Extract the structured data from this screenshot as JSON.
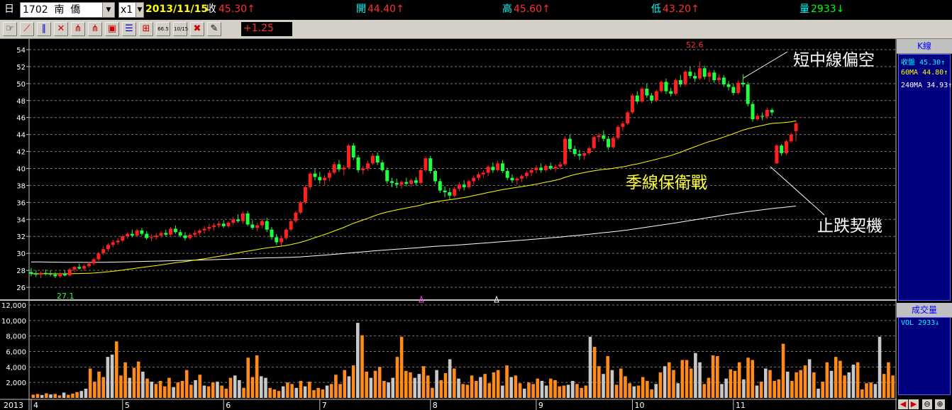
{
  "topbar": {
    "period_label": "日",
    "symbol": "1702  南  僑",
    "multiplier": "x1",
    "date": "2013/11/15",
    "close_label": "收",
    "close_value": "45.30↑",
    "open_label": "開",
    "open_value": "44.40↑",
    "high_label": "高",
    "high_value": "45.60↑",
    "low_label": "低",
    "low_value": "43.20↑",
    "vol_label": "量",
    "vol_value": "2933↓"
  },
  "toolbar": {
    "change_value": "+1.25",
    "icons": [
      "pointer-icon",
      "trendline-icon",
      "parallel-line-icon",
      "cross-line-icon",
      "fan-icon",
      "fibonacci-fan-icon",
      "box-icon",
      "horizontal-lines-icon",
      "gann-icon",
      "ratio-66-5-icon",
      "date-10-15-icon",
      "delete-icon",
      "pen-icon"
    ]
  },
  "side_panel": {
    "price_title": "K線",
    "legend": [
      {
        "label": "收盤 45.30↑",
        "color": "#00ffff"
      },
      {
        "label": "60MA 44.80↑",
        "color": "#ffff00"
      },
      {
        "label": "240MA 34.93↑",
        "color": "#ffffff"
      }
    ],
    "volume_title": "成交量",
    "volume_legend": "VOL 2933↓"
  },
  "chart_data": {
    "type": "candlestick",
    "y_ticks": [
      26,
      28,
      30,
      32,
      34,
      36,
      38,
      40,
      42,
      44,
      46,
      48,
      50,
      52,
      54
    ],
    "ylim": [
      25,
      55
    ],
    "volume_ticks": [
      "12,000",
      "10,000",
      "8,000",
      "6,000",
      "4,000",
      "2,000"
    ],
    "volume_ylim": [
      0,
      12000
    ],
    "x_axis_labels": [
      {
        "label": "2013",
        "day": -2
      },
      {
        "label": "4",
        "day": 0
      },
      {
        "label": "5",
        "day": 19
      },
      {
        "label": "6",
        "day": 40
      },
      {
        "label": "7",
        "day": 60
      },
      {
        "label": "8",
        "day": 83
      },
      {
        "label": "9",
        "day": 105
      },
      {
        "label": "10",
        "day": 125
      },
      {
        "label": "11",
        "day": 146
      }
    ],
    "peak_label": "52.6",
    "trough_label": "27.1",
    "annotations": [
      "短中線偏空",
      "季線保衛戰",
      "止跌契機"
    ],
    "ohlc": [
      [
        27.8,
        28.3,
        27.3,
        27.6
      ],
      [
        27.6,
        28.0,
        27.2,
        27.5
      ],
      [
        27.5,
        27.9,
        27.1,
        27.7
      ],
      [
        27.7,
        28.1,
        27.4,
        27.6
      ],
      [
        27.6,
        28.0,
        27.3,
        27.5
      ],
      [
        27.5,
        27.8,
        27.1,
        27.3
      ],
      [
        27.3,
        27.8,
        27.1,
        27.6
      ],
      [
        27.6,
        28.0,
        27.3,
        27.4
      ],
      [
        27.4,
        28.3,
        27.3,
        28.1
      ],
      [
        28.1,
        28.5,
        27.8,
        28.4
      ],
      [
        28.4,
        28.8,
        28.1,
        28.2
      ],
      [
        28.2,
        28.7,
        28.0,
        28.5
      ],
      [
        28.5,
        29.0,
        28.3,
        28.8
      ],
      [
        28.8,
        29.5,
        28.6,
        29.3
      ],
      [
        29.3,
        30.2,
        29.1,
        30.0
      ],
      [
        30.0,
        30.8,
        29.8,
        30.5
      ],
      [
        30.5,
        31.2,
        30.2,
        31.0
      ],
      [
        31.0,
        31.6,
        30.7,
        31.3
      ],
      [
        31.3,
        31.8,
        31.0,
        31.5
      ],
      [
        31.5,
        32.2,
        31.3,
        32.0
      ],
      [
        32.0,
        32.5,
        31.7,
        32.3
      ],
      [
        32.3,
        32.8,
        31.9,
        32.1
      ],
      [
        32.1,
        32.9,
        32.0,
        32.7
      ],
      [
        32.7,
        33.0,
        32.1,
        32.3
      ],
      [
        32.3,
        32.6,
        31.6,
        31.8
      ],
      [
        31.8,
        32.2,
        31.4,
        31.9
      ],
      [
        31.9,
        32.4,
        31.6,
        32.1
      ],
      [
        32.1,
        32.6,
        31.8,
        32.4
      ],
      [
        32.4,
        32.8,
        32.0,
        32.2
      ],
      [
        32.2,
        33.1,
        32.1,
        32.9
      ],
      [
        32.9,
        33.3,
        32.3,
        32.5
      ],
      [
        32.5,
        32.8,
        31.9,
        32.1
      ],
      [
        32.1,
        32.5,
        31.5,
        31.8
      ],
      [
        31.8,
        32.4,
        31.6,
        32.2
      ],
      [
        32.2,
        32.7,
        31.9,
        32.4
      ],
      [
        32.4,
        32.9,
        32.1,
        32.7
      ],
      [
        32.7,
        33.2,
        32.3,
        32.9
      ],
      [
        32.9,
        33.5,
        32.6,
        33.1
      ],
      [
        33.1,
        33.6,
        32.7,
        33.3
      ],
      [
        33.3,
        33.8,
        33.0,
        33.5
      ],
      [
        33.5,
        33.9,
        33.0,
        33.2
      ],
      [
        33.2,
        33.8,
        33.0,
        33.6
      ],
      [
        33.6,
        34.3,
        33.3,
        34.0
      ],
      [
        34.0,
        34.6,
        33.6,
        33.8
      ],
      [
        33.8,
        34.9,
        33.5,
        34.7
      ],
      [
        34.7,
        35.0,
        33.2,
        33.4
      ],
      [
        33.4,
        33.9,
        32.8,
        33.0
      ],
      [
        33.0,
        33.6,
        32.6,
        33.3
      ],
      [
        33.3,
        34.1,
        33.0,
        33.8
      ],
      [
        33.8,
        34.2,
        32.5,
        32.8
      ],
      [
        32.8,
        33.1,
        31.6,
        31.9
      ],
      [
        31.9,
        32.3,
        31.0,
        31.3
      ],
      [
        31.3,
        32.0,
        30.9,
        31.8
      ],
      [
        31.8,
        33.0,
        31.6,
        32.8
      ],
      [
        32.8,
        34.0,
        32.6,
        33.8
      ],
      [
        33.8,
        35.0,
        33.6,
        34.8
      ],
      [
        34.8,
        36.2,
        34.6,
        36.0
      ],
      [
        36.0,
        38.0,
        35.8,
        37.8
      ],
      [
        37.8,
        39.6,
        37.5,
        39.4
      ],
      [
        39.4,
        40.0,
        38.6,
        39.0
      ],
      [
        39.0,
        39.6,
        38.2,
        38.6
      ],
      [
        38.6,
        39.2,
        38.0,
        38.9
      ],
      [
        38.9,
        39.8,
        38.5,
        39.5
      ],
      [
        39.5,
        40.8,
        39.3,
        40.5
      ],
      [
        40.5,
        41.0,
        39.6,
        39.9
      ],
      [
        39.9,
        40.4,
        39.2,
        40.1
      ],
      [
        40.1,
        42.9,
        39.9,
        42.7
      ],
      [
        42.7,
        43.0,
        41.0,
        41.3
      ],
      [
        41.3,
        41.6,
        39.5,
        39.8
      ],
      [
        39.8,
        40.3,
        39.3,
        40.0
      ],
      [
        40.0,
        40.9,
        39.7,
        40.6
      ],
      [
        40.6,
        41.8,
        40.4,
        41.5
      ],
      [
        41.5,
        41.9,
        40.4,
        40.7
      ],
      [
        40.7,
        41.0,
        39.6,
        39.8
      ],
      [
        39.8,
        40.1,
        38.2,
        38.5
      ],
      [
        38.5,
        38.9,
        37.8,
        38.3
      ],
      [
        38.3,
        38.8,
        37.7,
        38.1
      ],
      [
        38.1,
        38.6,
        37.6,
        38.4
      ],
      [
        38.4,
        38.9,
        37.9,
        38.2
      ],
      [
        38.2,
        38.8,
        37.8,
        38.6
      ],
      [
        38.6,
        39.0,
        38.0,
        38.3
      ],
      [
        38.3,
        40.1,
        38.1,
        39.8
      ],
      [
        39.8,
        41.4,
        39.6,
        41.2
      ],
      [
        41.2,
        41.5,
        39.4,
        39.7
      ],
      [
        39.7,
        39.9,
        38.2,
        38.5
      ],
      [
        38.5,
        38.8,
        37.1,
        37.4
      ],
      [
        37.4,
        37.9,
        36.6,
        37.2
      ],
      [
        37.2,
        37.7,
        36.3,
        36.8
      ],
      [
        36.8,
        37.8,
        36.6,
        37.6
      ],
      [
        37.6,
        38.4,
        37.3,
        38.1
      ],
      [
        38.1,
        38.6,
        37.4,
        37.8
      ],
      [
        37.8,
        38.7,
        37.6,
        38.5
      ],
      [
        38.5,
        39.2,
        38.1,
        38.9
      ],
      [
        38.9,
        39.6,
        38.6,
        39.3
      ],
      [
        39.3,
        39.8,
        38.9,
        39.5
      ],
      [
        39.5,
        40.4,
        39.1,
        40.2
      ],
      [
        40.2,
        40.7,
        39.5,
        39.8
      ],
      [
        39.8,
        40.9,
        39.6,
        40.6
      ],
      [
        40.6,
        41.0,
        39.5,
        39.7
      ],
      [
        39.7,
        40.0,
        38.6,
        38.9
      ],
      [
        38.9,
        39.3,
        38.3,
        38.6
      ],
      [
        38.6,
        39.0,
        38.1,
        38.8
      ],
      [
        38.8,
        39.3,
        38.4,
        39.1
      ],
      [
        39.1,
        39.7,
        38.8,
        39.5
      ],
      [
        39.5,
        40.1,
        39.1,
        39.8
      ],
      [
        39.8,
        40.4,
        39.4,
        40.1
      ],
      [
        40.1,
        40.6,
        39.5,
        39.8
      ],
      [
        39.8,
        40.5,
        39.6,
        40.3
      ],
      [
        40.3,
        40.7,
        39.8,
        40.0
      ],
      [
        40.0,
        40.5,
        39.6,
        40.2
      ],
      [
        40.2,
        40.8,
        39.9,
        40.5
      ],
      [
        40.5,
        43.8,
        40.3,
        43.5
      ],
      [
        43.5,
        44.0,
        42.0,
        42.3
      ],
      [
        42.3,
        42.7,
        41.4,
        41.7
      ],
      [
        41.7,
        42.2,
        41.0,
        41.5
      ],
      [
        41.5,
        42.0,
        41.0,
        41.8
      ],
      [
        41.8,
        42.6,
        41.6,
        42.4
      ],
      [
        42.4,
        43.9,
        42.2,
        43.7
      ],
      [
        43.7,
        44.2,
        43.1,
        43.9
      ],
      [
        43.9,
        44.5,
        43.2,
        43.5
      ],
      [
        43.5,
        43.8,
        42.2,
        42.5
      ],
      [
        42.5,
        43.8,
        42.3,
        43.6
      ],
      [
        43.6,
        45.1,
        43.4,
        44.9
      ],
      [
        44.9,
        45.6,
        44.4,
        45.3
      ],
      [
        45.3,
        46.8,
        45.1,
        46.6
      ],
      [
        46.6,
        48.8,
        46.4,
        48.6
      ],
      [
        48.6,
        49.1,
        47.6,
        47.9
      ],
      [
        47.9,
        49.6,
        47.7,
        49.4
      ],
      [
        49.4,
        50.0,
        48.3,
        48.6
      ],
      [
        48.6,
        48.9,
        47.7,
        48.0
      ],
      [
        48.0,
        49.3,
        47.8,
        49.1
      ],
      [
        49.1,
        50.4,
        48.9,
        50.2
      ],
      [
        50.2,
        50.6,
        48.8,
        49.1
      ],
      [
        49.1,
        49.5,
        48.5,
        48.8
      ],
      [
        48.8,
        50.6,
        48.6,
        50.4
      ],
      [
        50.4,
        51.0,
        49.6,
        49.9
      ],
      [
        49.9,
        51.6,
        49.7,
        51.4
      ],
      [
        51.4,
        52.0,
        50.6,
        50.9
      ],
      [
        50.9,
        51.3,
        50.2,
        50.6
      ],
      [
        50.6,
        52.6,
        50.4,
        51.8
      ],
      [
        51.8,
        52.1,
        50.5,
        50.8
      ],
      [
        50.8,
        51.6,
        50.2,
        51.3
      ],
      [
        51.3,
        51.6,
        50.1,
        50.4
      ],
      [
        50.4,
        51.1,
        49.9,
        50.7
      ],
      [
        50.7,
        51.0,
        49.6,
        49.9
      ],
      [
        49.9,
        50.3,
        49.2,
        49.6
      ],
      [
        49.6,
        50.0,
        48.6,
        48.9
      ],
      [
        48.9,
        50.4,
        48.7,
        50.1
      ],
      [
        50.1,
        51.1,
        49.6,
        49.9
      ],
      [
        49.9,
        50.2,
        47.3,
        47.6
      ],
      [
        47.6,
        47.9,
        45.5,
        45.8
      ],
      [
        45.8,
        46.5,
        45.6,
        46.2
      ],
      [
        46.2,
        46.6,
        45.7,
        46.1
      ],
      [
        46.1,
        47.2,
        45.8,
        46.9
      ],
      [
        46.9,
        47.1,
        46.2,
        46.6
      ],
      [
        40.6,
        42.9,
        40.5,
        42.7
      ],
      [
        42.7,
        42.9,
        41.5,
        41.8
      ],
      [
        41.8,
        43.4,
        41.6,
        43.2
      ],
      [
        43.2,
        44.2,
        43.0,
        44.0
      ],
      [
        44.4,
        45.6,
        43.2,
        45.3
      ]
    ],
    "volume": [
      420,
      510,
      380,
      600,
      450,
      520,
      330,
      690,
      410,
      560,
      760,
      900,
      1200,
      3800,
      2100,
      3400,
      2700,
      5300,
      5600,
      7300,
      2900,
      4600,
      2600,
      3900,
      4700,
      3400,
      2500,
      2100,
      1800,
      2200,
      1500,
      2600,
      1400,
      2000,
      2200,
      3600,
      1700,
      2300,
      3000,
      1600,
      1500,
      2000,
      2100,
      1600,
      1200,
      2600,
      2900,
      2300,
      1300,
      5200,
      2700,
      5500,
      2800,
      2600,
      1300,
      1100,
      900,
      1500,
      2000,
      1800,
      1300,
      2200,
      1500,
      2100,
      1000,
      1300,
      1100,
      1600,
      1800,
      3000,
      1800,
      3600,
      2800,
      4200,
      9700,
      8100,
      3400,
      2600,
      3500,
      4000,
      2200,
      2000,
      2600,
      5300,
      7900,
      3500,
      3300,
      2600,
      3100,
      4100,
      2900,
      1300,
      3600,
      2300,
      3200,
      5000,
      3800,
      2500,
      1800,
      1700,
      2900,
      2200,
      2700,
      3100,
      1900,
      3300,
      3600,
      1600,
      4200,
      2700,
      2900,
      1900,
      1200,
      2000,
      1800,
      2500,
      2200,
      1600,
      2500,
      2300,
      1500,
      1600,
      1700,
      2200,
      1800,
      1300,
      1600,
      7900,
      6600,
      4100,
      3100,
      5400,
      3600,
      1700,
      3800,
      2800,
      1900,
      1500,
      1600,
      2700,
      2200,
      1100,
      1800,
      3300,
      4100,
      4600,
      3600,
      1900,
      4900,
      4900,
      3800,
      5800,
      4600,
      1800,
      2600,
      5500,
      5400,
      1800,
      2500,
      3700,
      3500,
      4600,
      2400,
      5200,
      4900,
      1600,
      2100,
      3800,
      3600,
      2200,
      2400,
      7000,
      3400,
      2200,
      3300,
      3600,
      4200,
      5000,
      3300,
      1200,
      2100,
      4600,
      3500,
      5300,
      4800,
      2900,
      3300,
      4300,
      4600,
      1100,
      1900,
      2000,
      1800,
      7900,
      3100,
      4600,
      2900
    ]
  }
}
